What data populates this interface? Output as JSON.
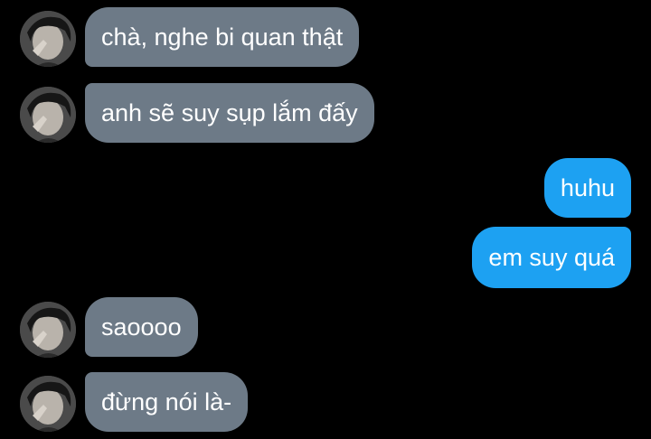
{
  "messages": [
    {
      "side": "incoming",
      "text": "chà, nghe bi quan thật",
      "has_avatar": true
    },
    {
      "side": "incoming",
      "text": "anh sẽ suy sụp lắm đấy",
      "has_avatar": true
    },
    {
      "side": "outgoing",
      "text": "huhu",
      "has_avatar": false
    },
    {
      "side": "outgoing",
      "text": "em suy quá",
      "has_avatar": false
    },
    {
      "side": "incoming",
      "text": "saoooo",
      "has_avatar": true
    },
    {
      "side": "incoming",
      "text": "đừng nói là-",
      "has_avatar": true
    }
  ],
  "colors": {
    "background": "#000000",
    "incoming_bubble": "#6d7a87",
    "outgoing_bubble": "#1da1f2",
    "text": "#ffffff"
  },
  "icons": {
    "avatar": "user-avatar-photo"
  }
}
